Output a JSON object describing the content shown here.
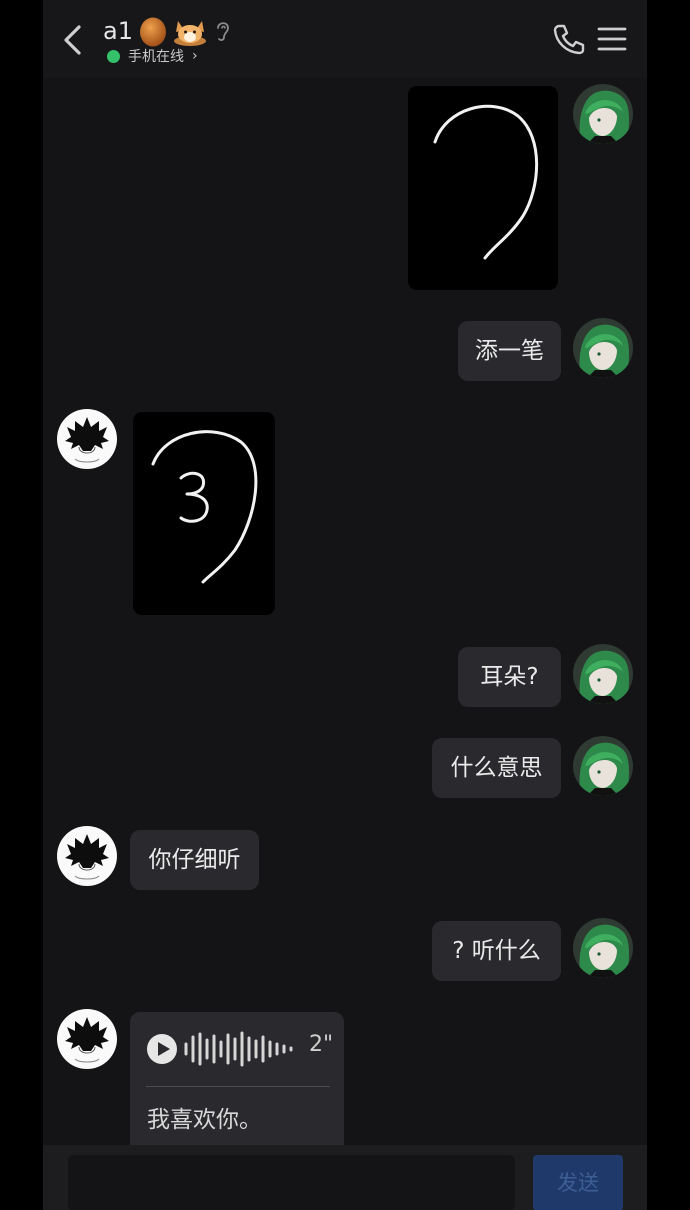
{
  "header": {
    "contact_name": "a1",
    "online_status": "手机在线",
    "status_chevron": "›"
  },
  "messages": [
    {
      "side": "right",
      "type": "image",
      "content": "drawing: ear outline"
    },
    {
      "side": "right",
      "type": "text",
      "text": "添一笔"
    },
    {
      "side": "left",
      "type": "image",
      "content": "drawing: ear outline with 3"
    },
    {
      "side": "right",
      "type": "text",
      "text": "耳朵?"
    },
    {
      "side": "right",
      "type": "text",
      "text": "什么意思"
    },
    {
      "side": "left",
      "type": "text",
      "text": "你仔细听"
    },
    {
      "side": "right",
      "type": "text",
      "text": "? 听什么"
    },
    {
      "side": "left",
      "type": "voice",
      "duration": "2\"",
      "transcript": "我喜欢你。"
    }
  ],
  "composer": {
    "send_label": "发送"
  },
  "colors": {
    "background": "#141416",
    "bubble": "#2a2a2e",
    "online_dot": "#35c06a",
    "send_button": "#1f3a6a"
  },
  "icons": [
    "back-arrow-icon",
    "egg-badge-icon",
    "corgi-badge-icon",
    "ear-icon",
    "phone-call-icon",
    "menu-icon",
    "play-icon"
  ]
}
